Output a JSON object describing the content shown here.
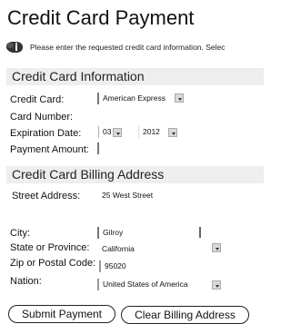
{
  "page_title": "Credit Card Payment",
  "info": {
    "icon": "info-icon",
    "text": "Please enter the requested credit card information. Selec"
  },
  "card_info": {
    "heading": "Credit Card Information",
    "card_label": "Credit Card:",
    "card_value": "American Express",
    "number_label": "Card Number:",
    "expiration_label": "Expiration Date:",
    "exp_month": "03",
    "exp_year": "2012",
    "amount_label": "Payment Amount:"
  },
  "billing": {
    "heading": "Credit Card Billing Address",
    "street_label": "Street Address:",
    "street_value": "25 West Street",
    "city_label": "City:",
    "city_value": "Gilroy",
    "state_label": "State or Province:",
    "state_value": "California",
    "zip_label": "Zip or Postal Code:",
    "zip_value": "95020",
    "nation_label": "Nation:",
    "nation_value": "United States of America"
  },
  "buttons": {
    "submit": "Submit Payment",
    "clear": "Clear Billing Address"
  }
}
